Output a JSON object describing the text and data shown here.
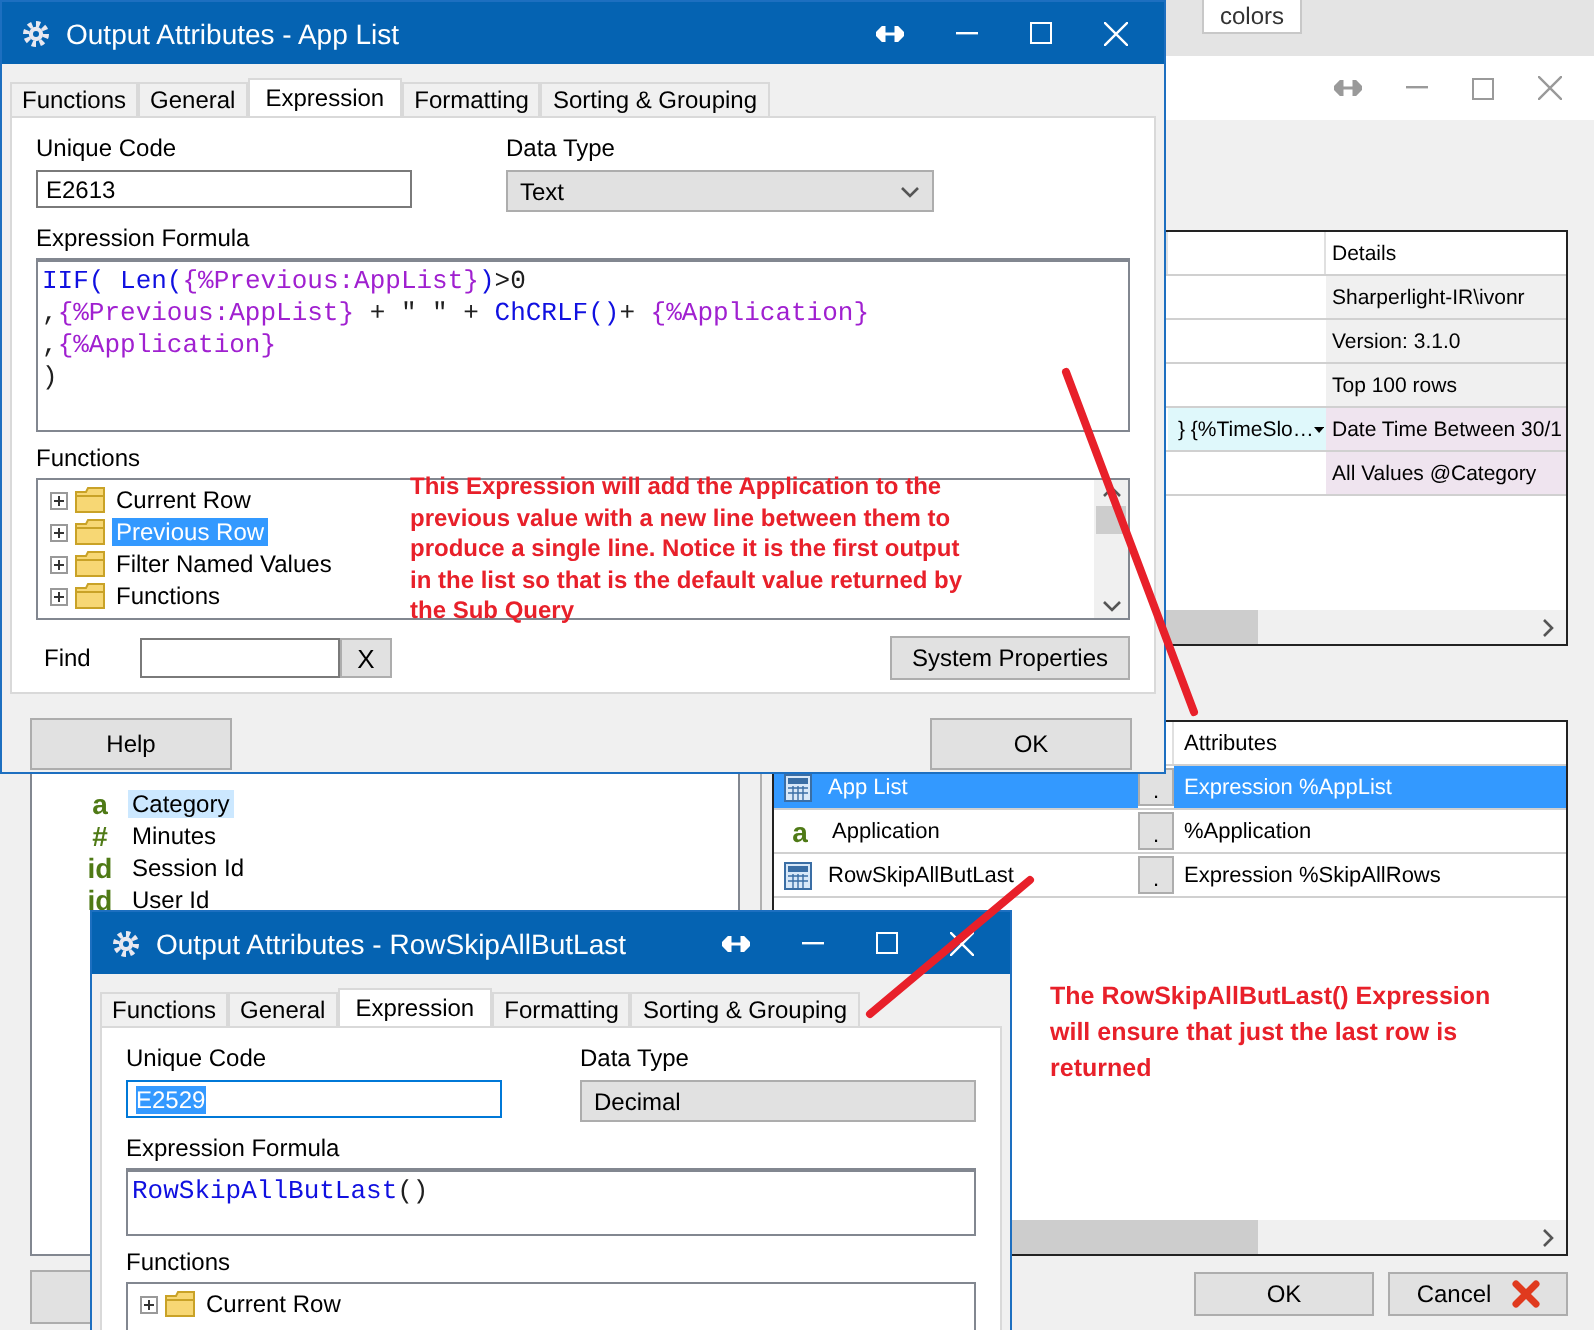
{
  "background_strip": {
    "tab": "colors"
  },
  "main_window": {
    "details_grid": {
      "header": "Details",
      "rows": [
        {
          "details": "Sharperlight-IR\\ivonr",
          "highlighted": false
        },
        {
          "details": "Version: 3.1.0",
          "highlighted": false
        },
        {
          "details": "Top 100 rows",
          "highlighted": false
        },
        {
          "cell": "} {%TimeSlo…",
          "details": "Date Time Between 30/1",
          "highlighted": true
        },
        {
          "details": "All Values @Category",
          "highlighted": true
        }
      ]
    },
    "attributes_grid": {
      "header": "Attributes",
      "rows": [
        {
          "kind": "expression",
          "name": "App List",
          "button": ".",
          "attributes": "Expression %AppList",
          "selected": true
        },
        {
          "kind": "field",
          "icon": "a",
          "name": "Application",
          "button": ".",
          "attributes": "%Application",
          "selected": false
        },
        {
          "kind": "expression",
          "name": "RowSkipAllButLast",
          "button": ".",
          "attributes": "Expression %SkipAllRows",
          "selected": false
        }
      ]
    },
    "buttons": [
      {
        "label": "OK",
        "kind": "ok"
      },
      {
        "label": "Cancel",
        "kind": "cancel"
      }
    ]
  },
  "field_tree": {
    "items": [
      {
        "icon": "a",
        "label": "Category",
        "selected": true
      },
      {
        "icon": "#",
        "label": "Minutes",
        "selected": false
      },
      {
        "icon": "id",
        "label": "Session Id",
        "selected": false
      },
      {
        "icon": "id",
        "label": "User Id",
        "selected": false
      }
    ]
  },
  "dialogs": [
    {
      "title": "Output Attributes - App List",
      "tabs": [
        {
          "label": "Functions",
          "selected": false
        },
        {
          "label": "General",
          "selected": false
        },
        {
          "label": "Expression",
          "selected": true
        },
        {
          "label": "Formatting",
          "selected": false
        },
        {
          "label": "Sorting & Grouping",
          "selected": false
        }
      ],
      "unique_code_label": "Unique Code",
      "unique_code": "E2613",
      "code_selected": false,
      "data_type_label": "Data Type",
      "data_type": "Text",
      "formula_label": "Expression Formula",
      "formula": [
        [
          {
            "kind": "function",
            "text": "IIF( "
          },
          {
            "kind": "function",
            "text": "Len("
          },
          {
            "kind": "field",
            "text": "{%Previous:AppList}"
          },
          {
            "kind": "function",
            "text": ")"
          },
          {
            "kind": "plain",
            "text": ">0"
          }
        ],
        [
          {
            "kind": "plain",
            "text": ","
          },
          {
            "kind": "field",
            "text": "{%Previous:AppList}"
          },
          {
            "kind": "plain",
            "text": " + \" \" + "
          },
          {
            "kind": "function",
            "text": "ChCRLF()"
          },
          {
            "kind": "plain",
            "text": "+ "
          },
          {
            "kind": "field",
            "text": "{%Application}"
          }
        ],
        [
          {
            "kind": "plain",
            "text": ","
          },
          {
            "kind": "field",
            "text": "{%Application}"
          }
        ],
        [
          {
            "kind": "plain",
            "text": ")"
          }
        ]
      ],
      "functions_label": "Functions",
      "functions": [
        {
          "label": "Current Row",
          "selected": false
        },
        {
          "label": "Previous Row",
          "selected": true
        },
        {
          "label": "Filter Named Values",
          "selected": false
        },
        {
          "label": "Functions",
          "selected": false
        }
      ],
      "find_label": "Find",
      "clear_button": "X",
      "system_button": "System Properties",
      "buttons": [
        "Help",
        "OK"
      ]
    },
    {
      "title": "Output Attributes - RowSkipAllButLast",
      "tabs": [
        {
          "label": "Functions",
          "selected": false
        },
        {
          "label": "General",
          "selected": false
        },
        {
          "label": "Expression",
          "selected": true
        },
        {
          "label": "Formatting",
          "selected": false
        },
        {
          "label": "Sorting & Grouping",
          "selected": false
        }
      ],
      "unique_code_label": "Unique Code",
      "unique_code": "E2529",
      "code_selected": true,
      "data_type_label": "Data Type",
      "data_type": "Decimal",
      "formula_label": "Expression Formula",
      "formula": [
        [
          {
            "kind": "function",
            "text": "RowSkipAllButLast"
          },
          {
            "kind": "plain",
            "text": "()"
          }
        ]
      ],
      "functions_label": "Functions",
      "functions": [
        {
          "label": "Current Row",
          "selected": false
        }
      ]
    }
  ],
  "annotations": [
    {
      "text": "This Expression will add the Application to the previous value with a new line between them to produce a single line.  Notice it is the first output in the list so that is the default value returned by the Sub Query"
    },
    {
      "text": "The RowSkipAllButLast() Expression will ensure that just the last row is returned"
    }
  ]
}
